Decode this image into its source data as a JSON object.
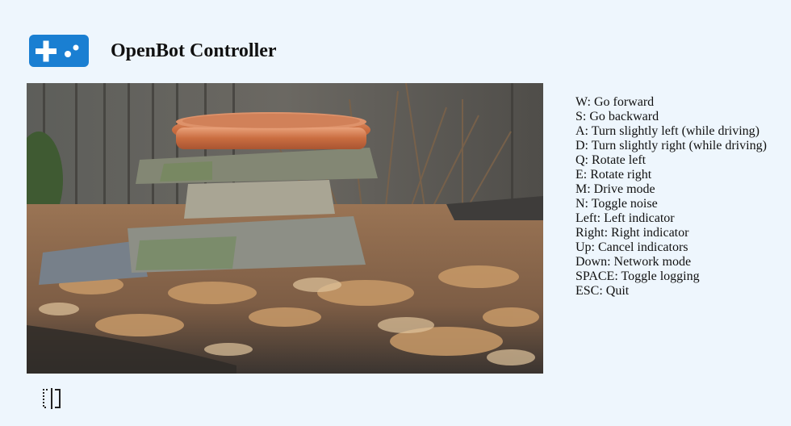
{
  "app": {
    "title": "OpenBot Controller",
    "logo_icon": "gamepad-icon",
    "brand_color": "#1a7fd2",
    "background_color": "#eef6fd"
  },
  "video": {
    "description_icon": "camera-feed"
  },
  "key_bindings": [
    "W: Go forward",
    "S: Go backward",
    "A: Turn slightly left (while driving)",
    "D: Turn slightly right (while driving)",
    "Q: Rotate left",
    "E: Rotate right",
    "M: Drive mode",
    "N: Toggle noise",
    "Left: Left indicator",
    "Right: Right indicator",
    "Up: Cancel indicators",
    "Down: Network mode",
    "SPACE: Toggle logging",
    "ESC: Quit"
  ],
  "footer": {
    "toggle_icon": "split-view-icon"
  }
}
